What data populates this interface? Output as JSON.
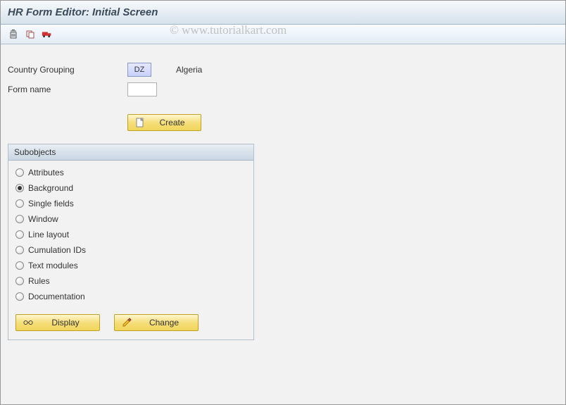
{
  "title": "HR Form Editor: Initial Screen",
  "watermark": "© www.tutorialkart.com",
  "toolbar": {
    "delete_tip": "Delete",
    "copy_tip": "Copy",
    "transport_tip": "Transport"
  },
  "form": {
    "country_label": "Country Grouping",
    "country_value": "DZ",
    "country_desc": "Algeria",
    "formname_label": "Form name",
    "formname_value": ""
  },
  "buttons": {
    "create": "Create",
    "display": "Display",
    "change": "Change"
  },
  "subobjects": {
    "header": "Subobjects",
    "items": [
      {
        "label": "Attributes",
        "checked": false
      },
      {
        "label": "Background",
        "checked": true
      },
      {
        "label": "Single fields",
        "checked": false
      },
      {
        "label": "Window",
        "checked": false
      },
      {
        "label": "Line layout",
        "checked": false
      },
      {
        "label": "Cumulation IDs",
        "checked": false
      },
      {
        "label": "Text modules",
        "checked": false
      },
      {
        "label": "Rules",
        "checked": false
      },
      {
        "label": "Documentation",
        "checked": false
      }
    ]
  }
}
